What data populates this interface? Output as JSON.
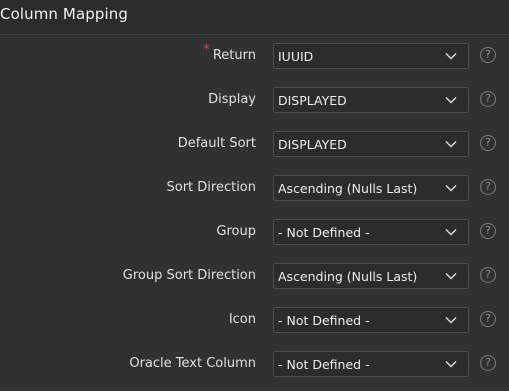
{
  "panel": {
    "title": "Column Mapping"
  },
  "fields": [
    {
      "label": "Return",
      "value": "IUUID",
      "required": true
    },
    {
      "label": "Display",
      "value": "DISPLAYED",
      "required": false
    },
    {
      "label": "Default Sort",
      "value": "DISPLAYED",
      "required": false
    },
    {
      "label": "Sort Direction",
      "value": "Ascending (Nulls Last)",
      "required": false
    },
    {
      "label": "Group",
      "value": "- Not Defined -",
      "required": false
    },
    {
      "label": "Group Sort Direction",
      "value": "Ascending (Nulls Last)",
      "required": false
    },
    {
      "label": "Icon",
      "value": "- Not Defined -",
      "required": false
    },
    {
      "label": "Oracle Text Column",
      "value": "- Not Defined -",
      "required": false
    }
  ],
  "icons": {
    "required": "required-asterisk-icon",
    "dropdown": "chevron-down-icon",
    "help": "help-icon"
  },
  "help_glyph": "?",
  "required_glyph": "*",
  "colors": {
    "background": "#313131",
    "header": "#2b2b2b",
    "select_bg": "#2c2c2c",
    "select_border": "#4d4d4d",
    "required": "#e04040"
  }
}
